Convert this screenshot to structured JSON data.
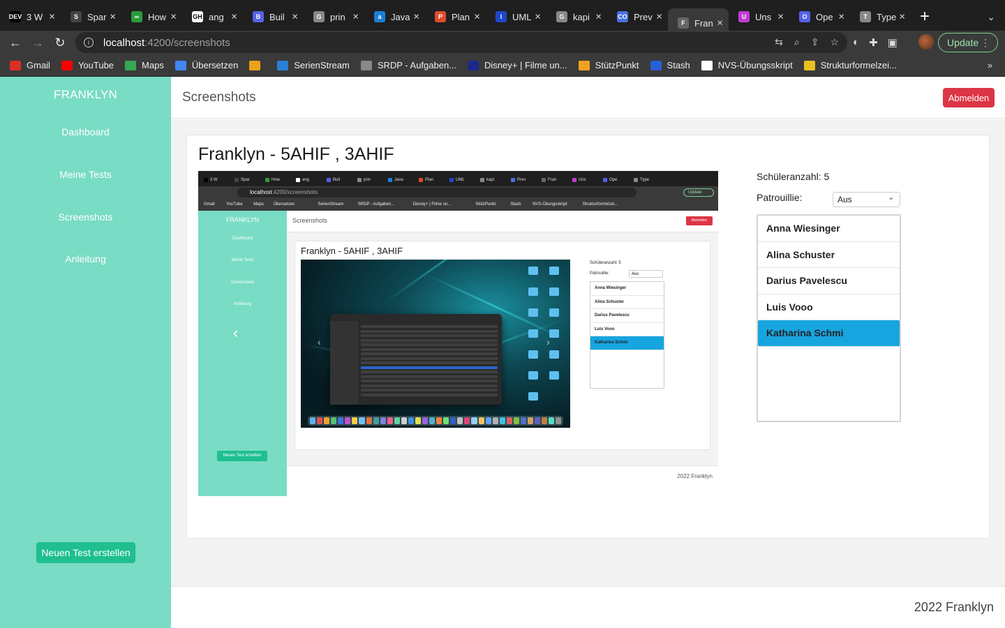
{
  "browser": {
    "tabs": [
      {
        "title": "3 W",
        "favicon": "DEV",
        "color": "#000000"
      },
      {
        "title": "Spar",
        "favicon": "S",
        "color": "#444444"
      },
      {
        "title": "How",
        "favicon": "∞",
        "color": "#2c9c3a"
      },
      {
        "title": "ang",
        "favicon": "GH",
        "color": "#ffffff"
      },
      {
        "title": "Buil",
        "favicon": "B",
        "color": "#5661e8"
      },
      {
        "title": "prin",
        "favicon": "G",
        "color": "#888888"
      },
      {
        "title": "Java",
        "favicon": "a",
        "color": "#1b7fd6"
      },
      {
        "title": "Plan",
        "favicon": "P",
        "color": "#e04b2f"
      },
      {
        "title": "UML",
        "favicon": "I",
        "color": "#1f47c8"
      },
      {
        "title": "kapi",
        "favicon": "G",
        "color": "#888888"
      },
      {
        "title": "Prev",
        "favicon": "CO",
        "color": "#4a6ee0"
      },
      {
        "title": "Fran",
        "favicon": "F",
        "color": "#666666",
        "active": true
      },
      {
        "title": "Uns",
        "favicon": "U",
        "color": "#c03cd0"
      },
      {
        "title": "Ope",
        "favicon": "O",
        "color": "#5661e8"
      },
      {
        "title": "Type",
        "favicon": "T",
        "color": "#888888"
      }
    ],
    "url_host": "localhost",
    "url_path": ":4200/screenshots",
    "update_label": "Update",
    "bookmarks": [
      {
        "label": "Gmail",
        "color": "#d93025"
      },
      {
        "label": "YouTube",
        "color": "#ff0000"
      },
      {
        "label": "Maps",
        "color": "#34a853"
      },
      {
        "label": "Übersetzen",
        "color": "#4285f4"
      },
      {
        "label": "",
        "color": "#e8a317"
      },
      {
        "label": "SerienStream",
        "color": "#2a7fd4"
      },
      {
        "label": "SRDP - Aufgaben...",
        "color": "#888888"
      },
      {
        "label": "Disney+ | Filme un...",
        "color": "#1b2a8a"
      },
      {
        "label": "StützPunkt",
        "color": "#f0a020"
      },
      {
        "label": "Stash",
        "color": "#2a5fd4"
      },
      {
        "label": "NVS-Übungsskript",
        "color": "#ffffff"
      },
      {
        "label": "Strukturformelzei...",
        "color": "#e8c020"
      }
    ],
    "more_label": "»"
  },
  "app": {
    "brand": "FRANKLYN",
    "nav": [
      "Dashboard",
      "Meine Tests",
      "Screenshots",
      "Anleitung"
    ],
    "new_test_label": "Neuen Test erstellen",
    "page_title": "Screenshots",
    "logout_label": "Abmelden",
    "card_title": "Franklyn - 5AHIF , 3AHIF",
    "student_count_label": "Schüleranzahl: 5",
    "patrol_label": "Patrouillie:",
    "patrol_value": "Aus",
    "students": [
      "Anna Wiesinger",
      "Alina Schuster",
      "Darius Pavelescu",
      "Luis Vooo",
      "Katharina Schmi"
    ],
    "selected_student": 4,
    "footer": "2022 Franklyn"
  },
  "colors": {
    "sidebar": "#79dcc4",
    "primary_button": "#1fbf90",
    "danger": "#dc3545",
    "selected": "#17a5e0"
  }
}
